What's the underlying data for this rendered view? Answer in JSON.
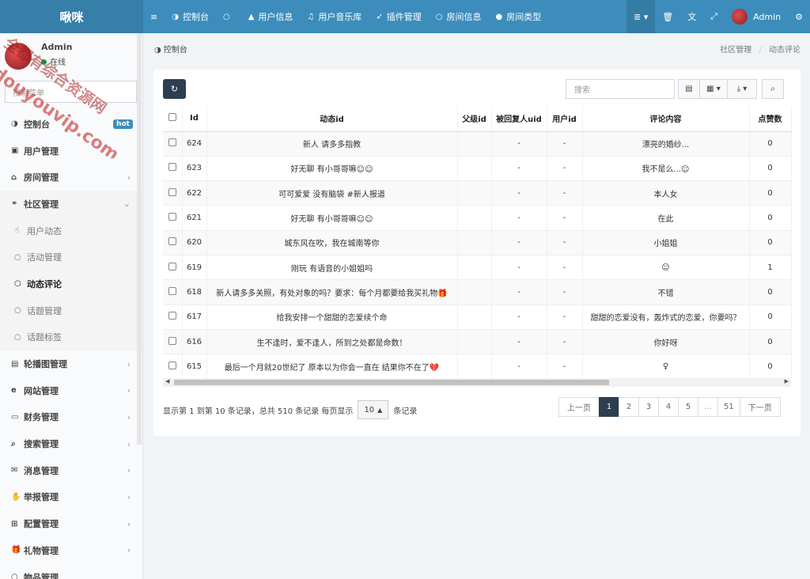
{
  "brand": "啾咪",
  "topnav": {
    "menu_toggle": "≡",
    "items": [
      {
        "label": "控制台",
        "icon": "dashboard-icon"
      },
      {
        "label": "",
        "icon": "circle-icon"
      },
      {
        "label": "用户信息",
        "icon": "user-icon"
      },
      {
        "label": "用户音乐库",
        "icon": "music-icon"
      },
      {
        "label": "插件管理",
        "icon": "rocket-icon"
      },
      {
        "label": "房间信息",
        "icon": "circle-icon"
      },
      {
        "label": "房间类型",
        "icon": "circle-filled-icon"
      }
    ],
    "right": {
      "user": "Admin"
    }
  },
  "sidebar": {
    "user_name": "Admin",
    "status": "在线",
    "search_placeholder": "搜索菜单",
    "items": [
      {
        "label": "控制台",
        "icon": "dashboard-icon",
        "badge": "hot"
      },
      {
        "label": "用户管理",
        "icon": "user-icon"
      },
      {
        "label": "房间管理",
        "icon": "bank-icon",
        "caret": "‹"
      },
      {
        "label": "社区管理",
        "icon": "bicycle-icon",
        "caret": "⌄"
      },
      {
        "label": "轮播图管理",
        "icon": "image-icon",
        "caret": "‹"
      },
      {
        "label": "网站管理",
        "icon": "ie-icon",
        "caret": "‹"
      },
      {
        "label": "财务管理",
        "icon": "money-icon",
        "caret": "‹"
      },
      {
        "label": "搜索管理",
        "icon": "search-icon",
        "caret": "‹"
      },
      {
        "label": "消息管理",
        "icon": "envelope-icon",
        "caret": "‹"
      },
      {
        "label": "举报管理",
        "icon": "hand-icon",
        "caret": "‹"
      },
      {
        "label": "配置管理",
        "icon": "sitemap-icon",
        "caret": "‹"
      },
      {
        "label": "礼物管理",
        "icon": "gift-icon",
        "caret": "‹"
      },
      {
        "label": "物品管理",
        "icon": "circle-icon"
      }
    ],
    "subitems": [
      {
        "label": "用户动态",
        "icon": "thumbs-icon"
      },
      {
        "label": "活动管理",
        "icon": "circle-icon"
      },
      {
        "label": "动态评论",
        "icon": "circle-icon"
      },
      {
        "label": "话题管理",
        "icon": "circle-icon"
      },
      {
        "label": "话题标签",
        "icon": "circle-icon"
      }
    ]
  },
  "breadcrumb": {
    "left": "控制台",
    "right_parent": "社区管理",
    "right_current": "动态评论",
    "sep": "/"
  },
  "toolbar": {
    "search_placeholder": "搜索"
  },
  "table": {
    "headers": [
      "Id",
      "动态id",
      "父级id",
      "被回复人uid",
      "用户id",
      "评论内容",
      "点赞数"
    ],
    "rows": [
      [
        "624",
        "新人 请多多指教",
        "",
        "-",
        "-",
        "漂亮的婚纱...",
        "0"
      ],
      [
        "623",
        "好无聊 有小哥哥嘛☺☺",
        "",
        "-",
        "-",
        "我不是么...☺",
        "0"
      ],
      [
        "622",
        "可可爱爱 没有脑袋 #新人报道",
        "",
        "-",
        "-",
        "本人女",
        "0"
      ],
      [
        "621",
        "好无聊 有小哥哥嘛☺☺",
        "",
        "-",
        "-",
        "在此",
        "0"
      ],
      [
        "620",
        "城东风在吹，我在城南等你",
        "",
        "-",
        "-",
        "小姐姐",
        "0"
      ],
      [
        "619",
        "刚玩 有语音的小姐姐吗",
        "",
        "-",
        "-",
        "☺",
        "1"
      ],
      [
        "618",
        "新人请多多关照，有处对象的吗？要求：每个月都要给我买礼物🎁",
        "",
        "-",
        "-",
        "不错",
        "0"
      ],
      [
        "617",
        "给我安排一个甜甜的恋爱续个命",
        "",
        "-",
        "-",
        "甜甜的恋爱没有，轰炸式的恋爱，你要吗？",
        "0"
      ],
      [
        "616",
        "生不逢时，爱不逢人，所到之处都是命数！",
        "",
        "-",
        "-",
        "你好呀",
        "0"
      ],
      [
        "615",
        "最后一个月就20世纪了 原本以为你会一直在 结果你不在了💔",
        "",
        "-",
        "-",
        "♀",
        "0"
      ]
    ]
  },
  "footer": {
    "info_prefix": "显示第 1 到第 10 条记录，总共 510 条记录 每页显示",
    "page_size": "10",
    "info_suffix": "条记录"
  },
  "pager": {
    "prev": "上一页",
    "pages": [
      "1",
      "2",
      "3",
      "4",
      "5",
      "...",
      "51"
    ],
    "next": "下一页"
  },
  "watermark": {
    "line1": "全都有综合资源网",
    "line2": "douyouvip.com"
  }
}
